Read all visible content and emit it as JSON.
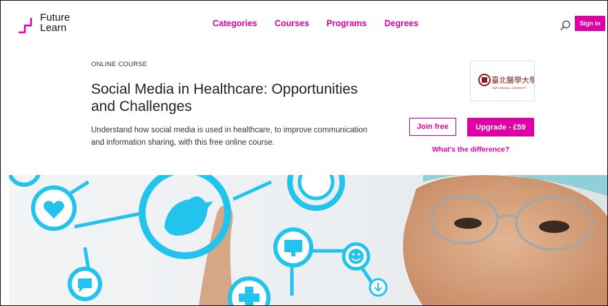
{
  "header": {
    "brand_line1": "Future",
    "brand_line2": "Learn",
    "nav": [
      "Categories",
      "Courses",
      "Programs",
      "Degrees"
    ],
    "sign_in": "Sign in"
  },
  "course": {
    "kicker": "ONLINE COURSE",
    "title": "Social Media in Healthcare: Opportunities and Challenges",
    "description": "Understand how social media is used in healthcare, to improve communication and information sharing, with this free online course.",
    "join_label": "Join free",
    "upgrade_label": "Upgrade - £59",
    "difference_link": "What's the difference?",
    "university_logo_text": "臺北醫學大學",
    "university_logo_subtext": "TAIPEI MEDICAL UNIVERSITY"
  },
  "colors": {
    "accent": "#de00a5",
    "hero_icon": "#22c4ee"
  },
  "icons": [
    "search-icon",
    "futurelearn-logo",
    "university-logo",
    "heart-icon",
    "twitter-bird-icon",
    "monitor-icon",
    "smiley-icon",
    "download-icon",
    "chat-icon"
  ]
}
